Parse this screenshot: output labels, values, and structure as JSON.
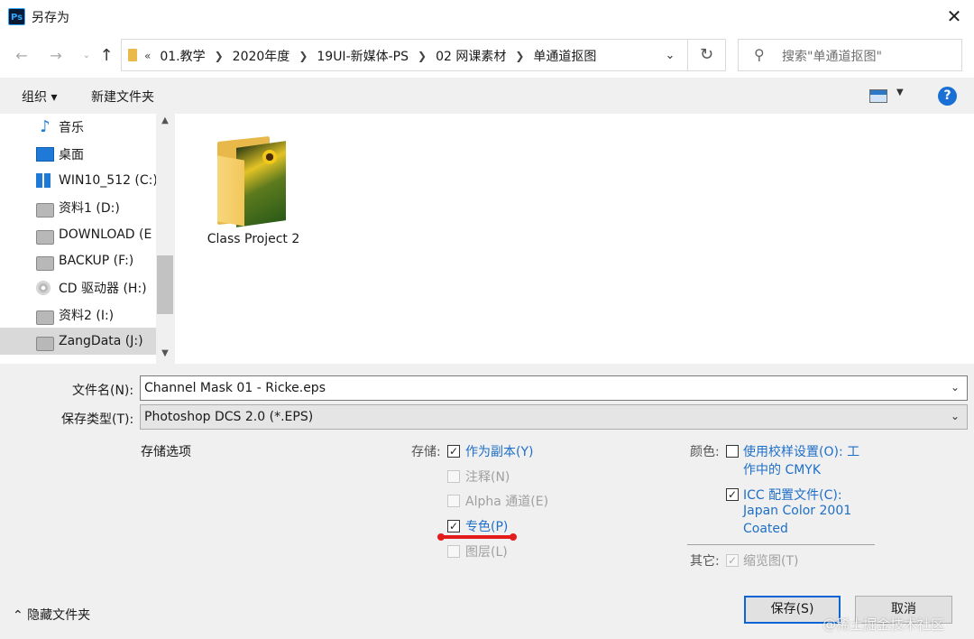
{
  "window": {
    "title": "另存为",
    "app_icon": "Ps",
    "close_glyph": "✕"
  },
  "nav": {
    "breadcrumb_overflow": "«",
    "breadcrumbs": [
      "01.教学",
      "2020年度",
      "19UI-新媒体-PS",
      "02 网课素材",
      "单通道抠图"
    ],
    "search_placeholder": "搜索\"单通道抠图\""
  },
  "toolbar": {
    "organize": "组织 ▾",
    "new_folder": "新建文件夹",
    "help": "?"
  },
  "sidebar": {
    "items": [
      {
        "label": "音乐",
        "icon": "music-icon"
      },
      {
        "label": "桌面",
        "icon": "desktop-icon"
      },
      {
        "label": "WIN10_512 (C:)",
        "icon": "windows-drive-icon"
      },
      {
        "label": "资料1 (D:)",
        "icon": "drive-icon"
      },
      {
        "label": "DOWNLOAD (E",
        "icon": "drive-icon"
      },
      {
        "label": "BACKUP (F:)",
        "icon": "drive-icon"
      },
      {
        "label": "CD 驱动器 (H:)",
        "icon": "cd-drive-icon"
      },
      {
        "label": "资料2 (I:)",
        "icon": "drive-icon"
      },
      {
        "label": "ZangData (J:)",
        "icon": "drive-icon",
        "selected": true
      }
    ]
  },
  "files": [
    {
      "name": "Class Project 2",
      "icon": "folder-icon"
    }
  ],
  "form": {
    "filename_label": "文件名(N):",
    "filename_value": "Channel Mask 01 - Ricke.eps",
    "type_label": "保存类型(T):",
    "type_value": "Photoshop DCS 2.0 (*.EPS)"
  },
  "options": {
    "title": "存储选项",
    "save_label": "存储:",
    "as_copy": "作为副本(Y)",
    "notes": "注释(N)",
    "alpha": "Alpha 通道(E)",
    "spot": "专色(P)",
    "layers": "图层(L)",
    "color_label": "颜色:",
    "proof_line1": "使用校样设置(O): 工",
    "proof_line2": "作中的 CMYK",
    "icc_line1": "ICC 配置文件(C):",
    "icc_line2": "Japan Color 2001",
    "icc_line3": "Coated",
    "other_label": "其它:",
    "thumbnail": "缩览图(T)",
    "check": "✓"
  },
  "footer": {
    "hide_folders": "⌃ 隐藏文件夹",
    "save_button": "保存(S)",
    "cancel_button": "取消",
    "watermark": "@稀土掘金技术社区"
  },
  "colors": {
    "accent": "#1e6fc8",
    "annotation": "#e31b1b",
    "button_focus": "#0a64d6"
  }
}
